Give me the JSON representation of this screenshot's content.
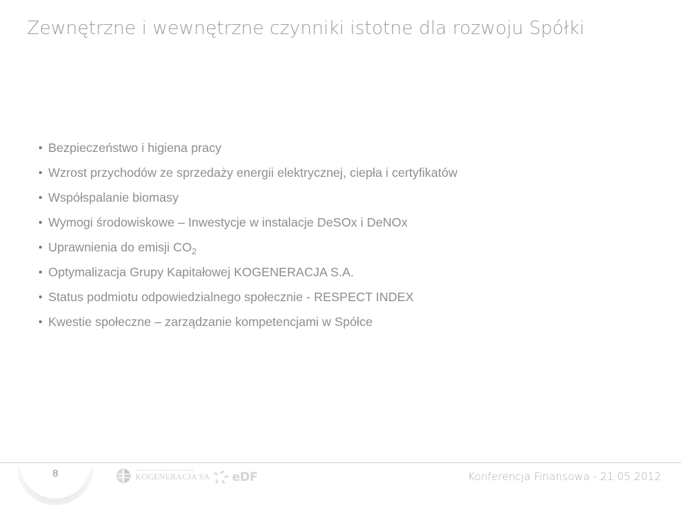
{
  "slide": {
    "title": "Zewnętrzne i wewnętrzne czynniki istotne dla rozwoju Spółki",
    "title_color": "#9d9d9d",
    "background_color": "#ffffff",
    "body_text_color": "#8e8e8e",
    "bullet_marker_color": "#7a7f63"
  },
  "bullets": [
    {
      "text": "Bezpieczeństwo i higiena pracy"
    },
    {
      "text": "Wzrost przychodów ze sprzedaży energii elektrycznej, ciepła i certyfikatów"
    },
    {
      "text": "Współspalanie biomasy"
    },
    {
      "text": "Wymogi środowiskowe – Inwestycje w instalacje DeSOx i DeNOx"
    },
    {
      "text": "Uprawnienia do emisji CO",
      "subscript": "2"
    },
    {
      "text": "Optymalizacja Grupy Kapitałowej KOGENERACJA S.A."
    },
    {
      "text": "Status podmiotu odpowiedzialnego społecznie - RESPECT INDEX"
    },
    {
      "text": "Kwestie społeczne – zarządzanie kompetencjami w Spółce"
    }
  ],
  "footer": {
    "page_number": "8",
    "caption": "Konferencja Finansowa - 21 05 2012",
    "caption_color": "#b0b0b0",
    "divider_color": "#d2d2d2",
    "logos": [
      {
        "name": "KOGENERACJA SA",
        "tagline": "Zespół Elektrociepłowni Wrocławskich",
        "color": "#cdcdcd"
      },
      {
        "name": "eDF",
        "color": "#d4d4d4"
      }
    ]
  }
}
